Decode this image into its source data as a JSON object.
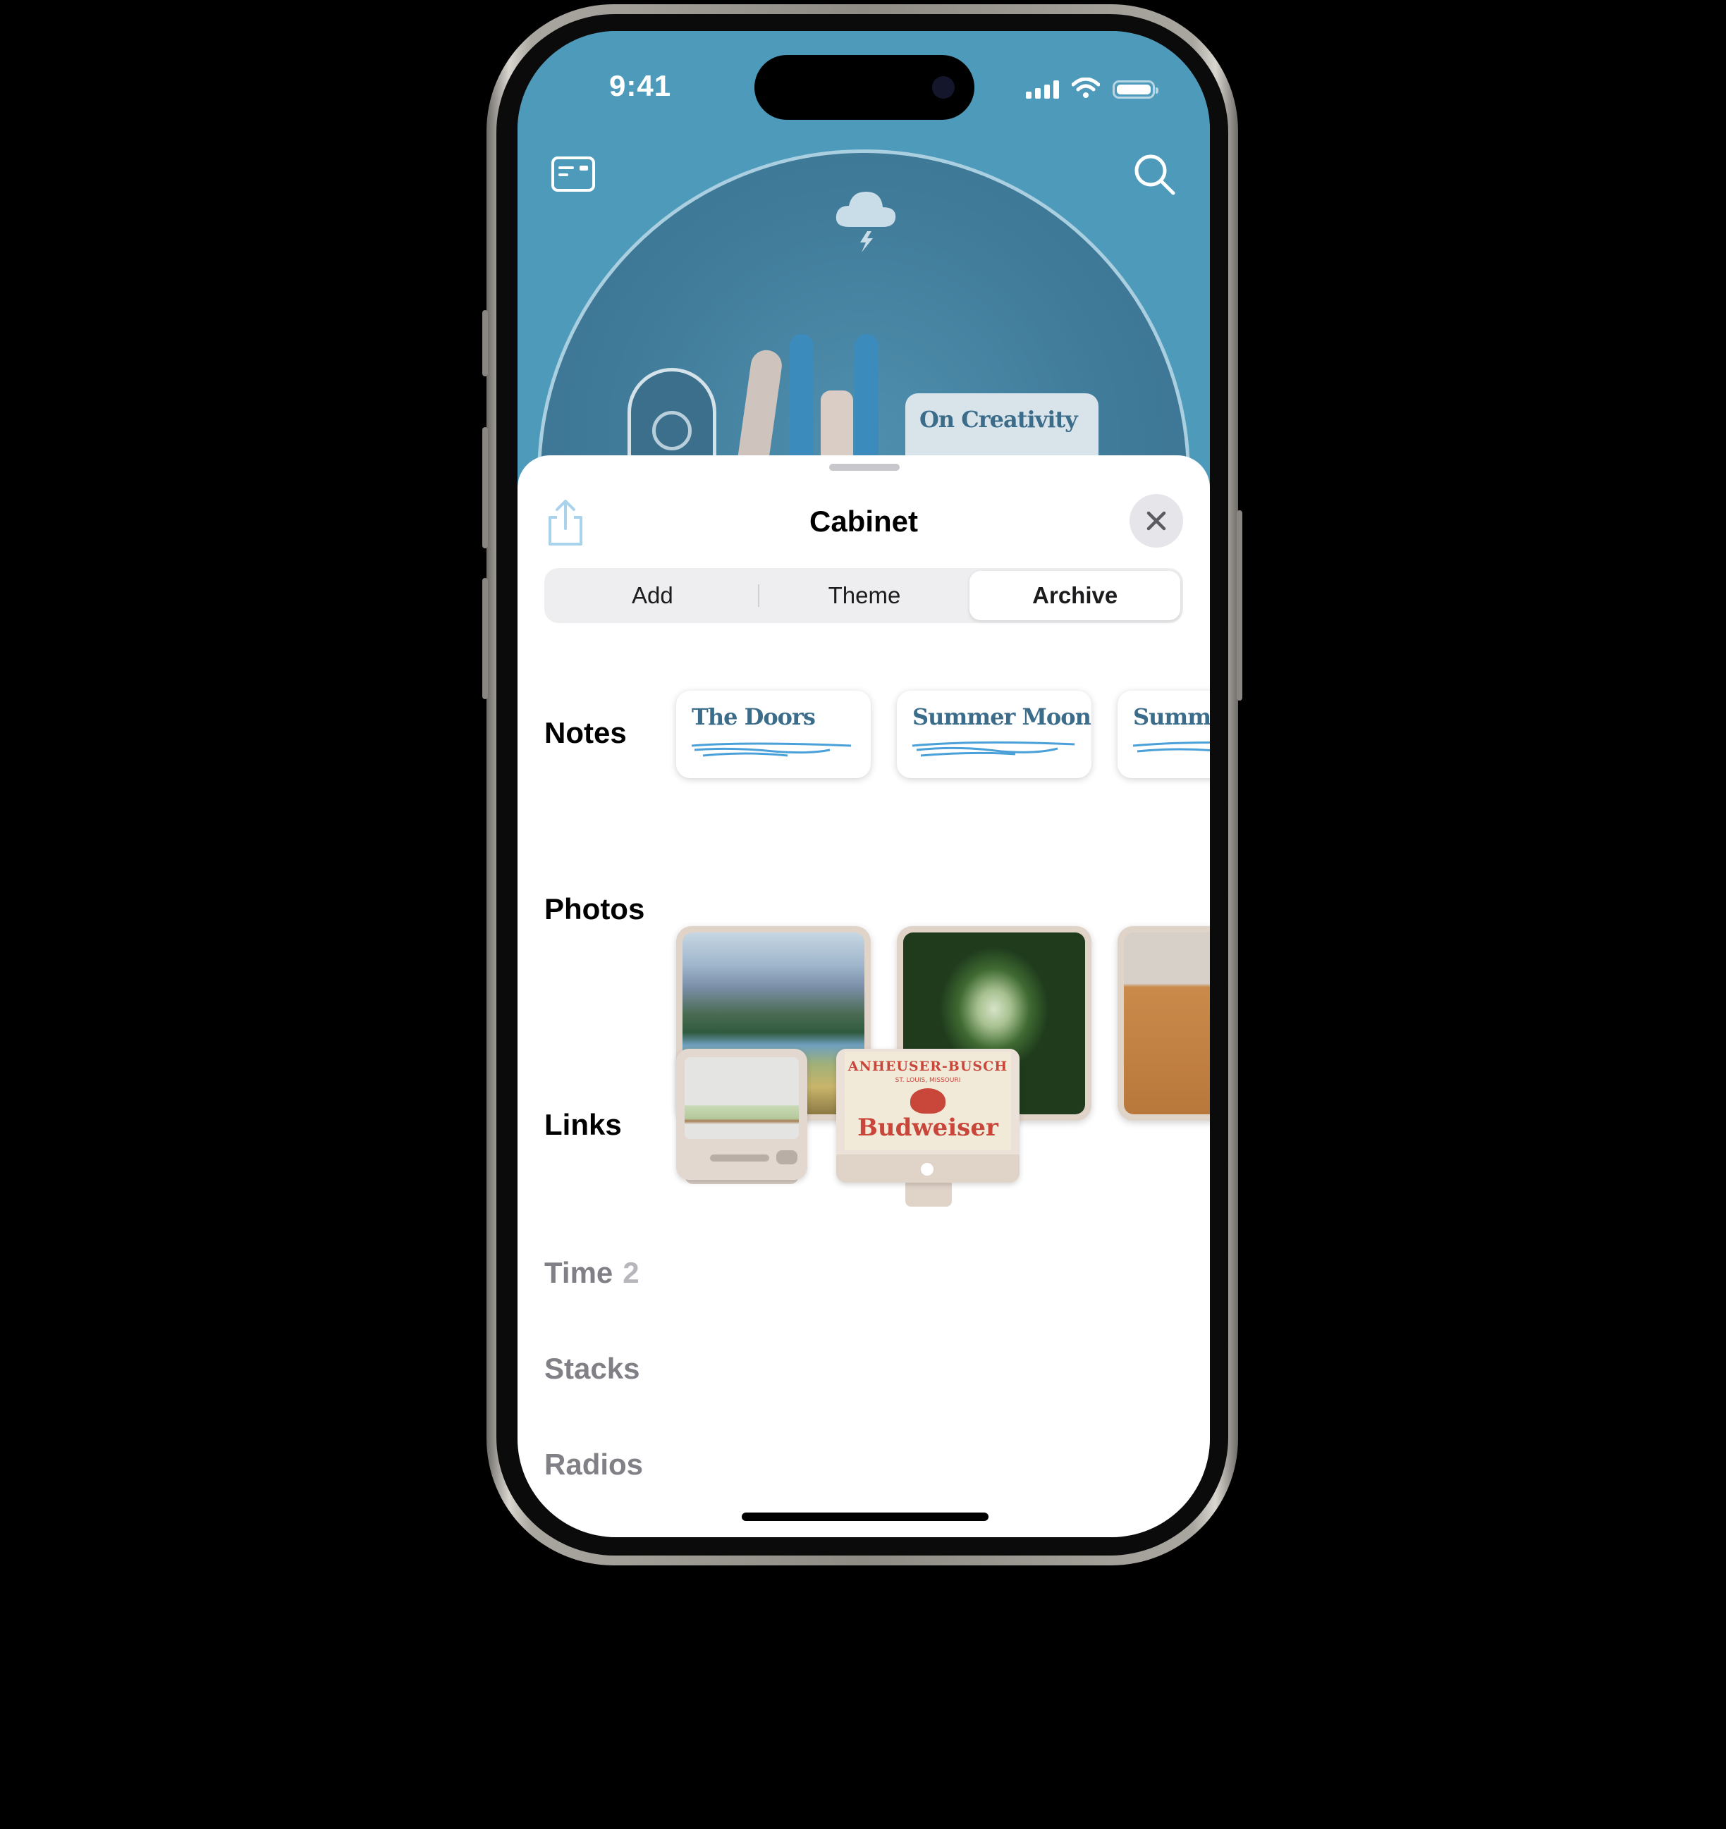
{
  "status_bar": {
    "time": "9:41"
  },
  "hero": {
    "weather_icon": "cloud-lightning-icon",
    "left_icon": "card-icon",
    "right_icon": "search-icon",
    "featured_note_title": "On Creativity"
  },
  "sheet": {
    "title": "Cabinet",
    "share_icon": "share-icon",
    "close_icon": "close-icon",
    "tabs": [
      {
        "label": "Add",
        "active": false
      },
      {
        "label": "Theme",
        "active": false
      },
      {
        "label": "Archive",
        "active": true
      }
    ],
    "sections": {
      "notes": {
        "label": "Notes",
        "items": [
          {
            "title": "The Doors"
          },
          {
            "title": "Summer Moon"
          },
          {
            "title": "Summer"
          }
        ]
      },
      "photos": {
        "label": "Photos"
      },
      "links": {
        "label": "Links",
        "badge_text": [
          "ANHEUSER-BUSCH",
          "ST. LOUIS, MISSOURI",
          "Budweiser"
        ]
      },
      "time": {
        "label": "Time",
        "count": "2"
      },
      "stacks": {
        "label": "Stacks"
      },
      "radios": {
        "label": "Radios"
      }
    }
  },
  "colors": {
    "hero_bg": "#4e9aba",
    "note_text": "#3b6d8b",
    "scribble": "#4aa0d8",
    "card_beige": "#e0d3c8"
  }
}
